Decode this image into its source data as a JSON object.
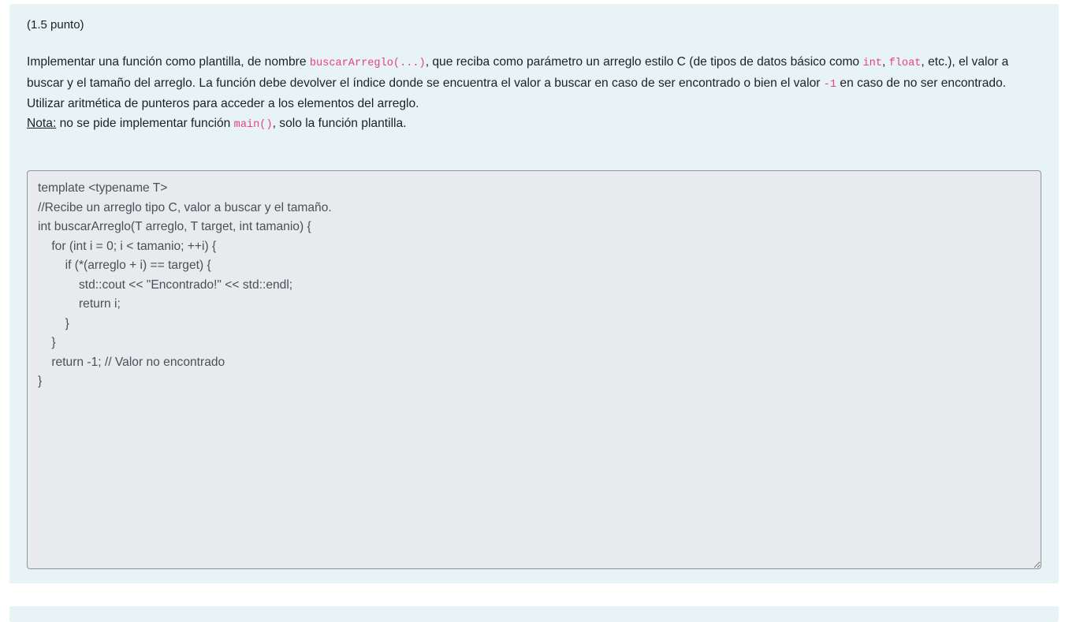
{
  "question": {
    "points": "(1.5 punto)",
    "prompt": {
      "t1": "Implementar una función como plantilla, de nombre ",
      "c1": "buscarArreglo(...)",
      "t2": ", que reciba como parámetro un arreglo estilo C (de tipos de datos básico como ",
      "c2": "int",
      "t3": ", ",
      "c3": "float",
      "t4": ", etc.), el valor a buscar y el tamaño del arreglo. La función debe devolver el índice donde se encuentra el valor a buscar en caso de ser encontrado o bien el valor ",
      "c4": "-1",
      "t5": " en caso de no ser encontrado. Utilizar aritmética de punteros para acceder a los elementos del arreglo."
    },
    "note": {
      "label": "Nota:",
      "t1": " no se pide implementar función ",
      "c1": "main()",
      "t2": ", solo la función plantilla."
    },
    "answer": "template <typename T>\n//Recibe un arreglo tipo C, valor a buscar y el tamaño.\nint buscarArreglo(T arreglo, T target, int tamanio) {\n    for (int i = 0; i < tamanio; ++i) {\n        if (*(arreglo + i) == target) {\n            std::cout << \"Encontrado!\" << std::endl;\n            return i;\n        }\n    }\n    return -1; // Valor no encontrado\n}"
  },
  "colors": {
    "card_background": "#e7f3f5",
    "code_accent": "#e83e8c",
    "textarea_background": "#e8eaed"
  }
}
